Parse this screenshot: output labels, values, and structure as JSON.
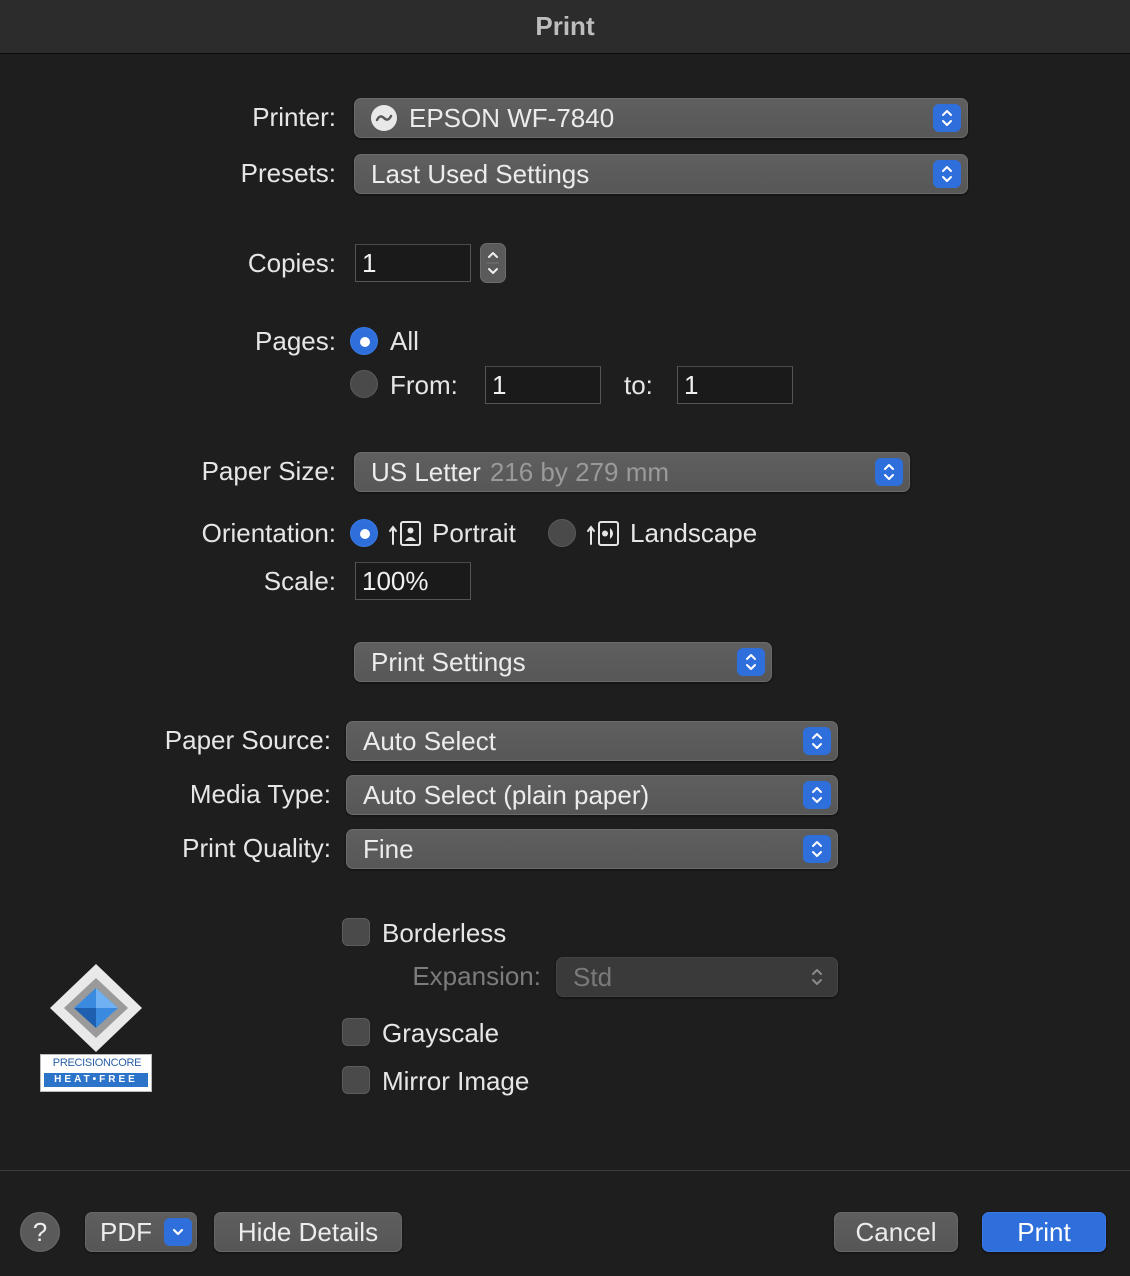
{
  "window": {
    "title": "Print"
  },
  "printer": {
    "label": "Printer:",
    "value": "EPSON WF-7840"
  },
  "presets": {
    "label": "Presets:",
    "value": "Last Used Settings"
  },
  "copies": {
    "label": "Copies:",
    "value": "1"
  },
  "pages": {
    "label": "Pages:",
    "all_label": "All",
    "all_selected": true,
    "from_label": "From:",
    "from_value": "1",
    "to_label": "to:",
    "to_value": "1"
  },
  "paper_size": {
    "label": "Paper Size:",
    "value": "US Letter",
    "detail": "216 by 279 mm"
  },
  "orientation": {
    "label": "Orientation:",
    "portrait_label": "Portrait",
    "landscape_label": "Landscape",
    "selected": "Portrait"
  },
  "scale": {
    "label": "Scale:",
    "value": "100%"
  },
  "section_popup": {
    "value": "Print Settings"
  },
  "print_settings": {
    "paper_source": {
      "label": "Paper Source:",
      "value": "Auto Select"
    },
    "media_type": {
      "label": "Media Type:",
      "value": "Auto Select (plain paper)"
    },
    "print_quality": {
      "label": "Print Quality:",
      "value": "Fine"
    },
    "borderless": {
      "label": "Borderless",
      "checked": false
    },
    "expansion": {
      "label": "Expansion:",
      "value": "Std",
      "enabled": false
    },
    "grayscale": {
      "label": "Grayscale",
      "checked": false
    },
    "mirror_image": {
      "label": "Mirror Image",
      "checked": false
    }
  },
  "logo": {
    "top_text": "PRECISIONCORE",
    "bottom_text": "HEAT•FREE"
  },
  "footer": {
    "help_label": "?",
    "pdf_label": "PDF",
    "hide_details_label": "Hide Details",
    "cancel_label": "Cancel",
    "print_label": "Print"
  },
  "colors": {
    "accent": "#2e6fdc",
    "background": "#1e1e1e",
    "control": "#5a5a5a"
  }
}
